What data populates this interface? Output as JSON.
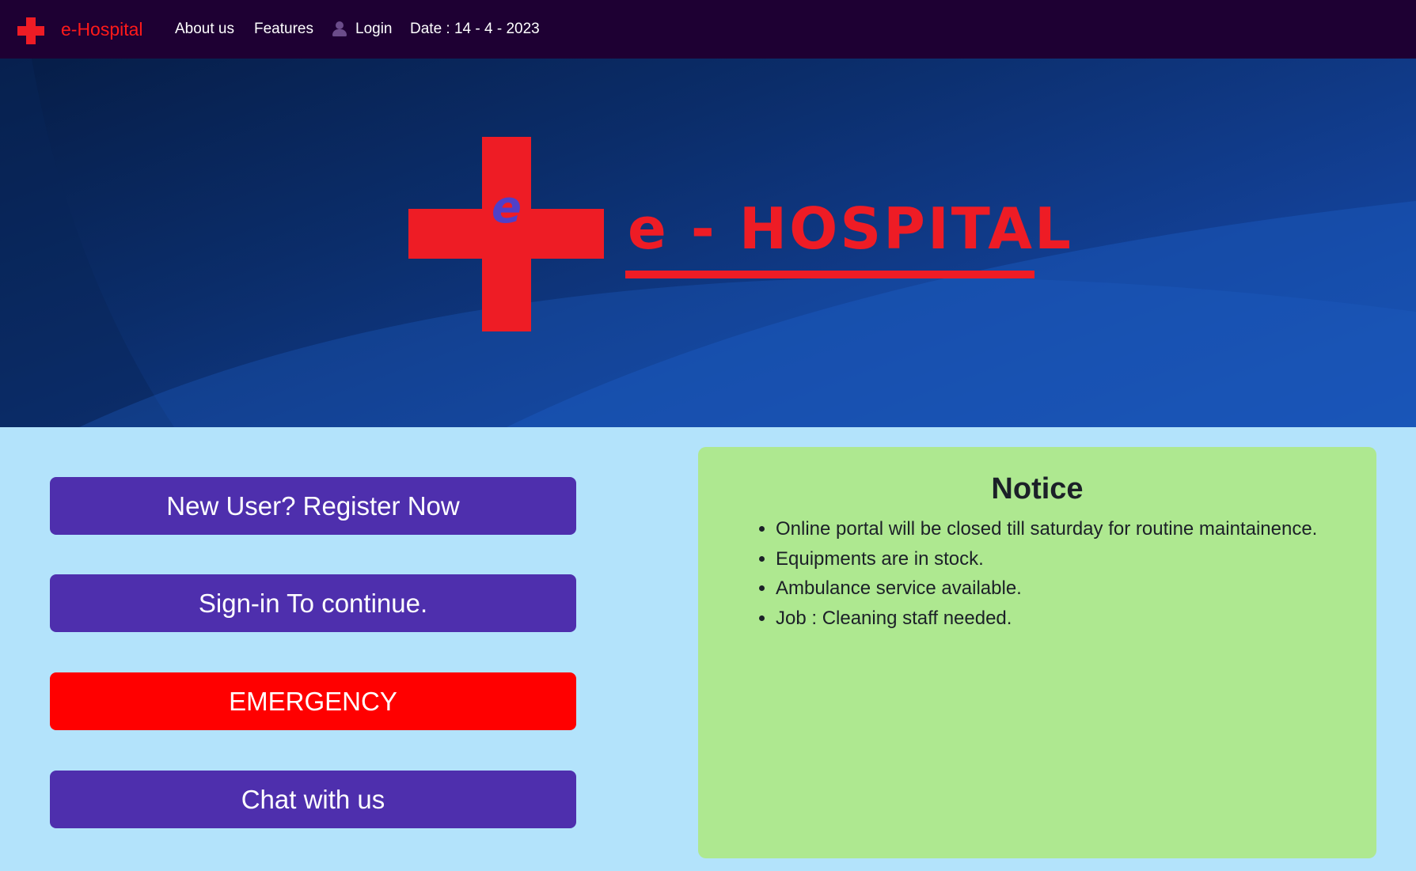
{
  "nav": {
    "brand": "e-Hospital",
    "about": "About us",
    "features": "Features",
    "login": "Login",
    "date": "Date : 14 - 4 - 2023"
  },
  "hero": {
    "logo_letter": "e",
    "title": "e - HOSPITAL"
  },
  "actions": {
    "register": "New User? Register Now",
    "signin": "Sign-in To continue.",
    "emergency": "EMERGENCY",
    "chat": "Chat with us"
  },
  "notice": {
    "title": "Notice",
    "items": [
      "Online portal will be closed till saturday for routine maintainence.",
      "Equipments are in stock.",
      "Ambulance service available.",
      "Job : Cleaning staff needed."
    ]
  },
  "colors": {
    "navbar": "#1e0033",
    "brand_red": "#ee1c25",
    "button_purple": "#4e2fad",
    "emergency_red": "#ff0000",
    "page_bg": "#b3e3fb",
    "notice_bg": "#aee890"
  },
  "icons": {
    "nav_logo": "red-cross-icon",
    "login": "user-icon"
  }
}
